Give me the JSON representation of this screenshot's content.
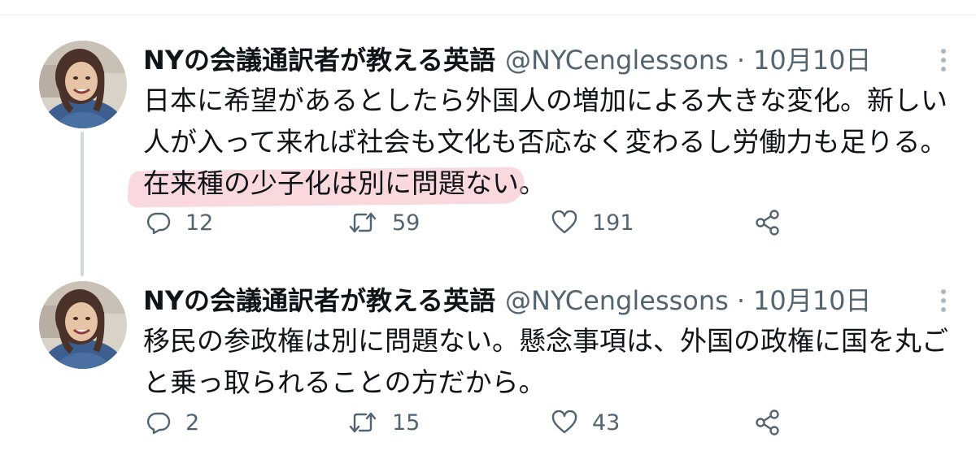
{
  "tweets": [
    {
      "display_name": "NYの会議通訳者が教える英語",
      "handle": "@NYCenglessons",
      "separator": "·",
      "date": "10月10日",
      "text_before_highlight": "日本に希望があるとしたら外国人の増加による大きな変化。新しい人が入って来れば社会も文化も否応なく変わるし労働力も足りる。",
      "text_highlighted": "在来種の少子化は別に問題ない",
      "text_after_highlight": "。",
      "highlight_color": "#f2a9b1",
      "replies": "12",
      "retweets": "59",
      "likes": "191"
    },
    {
      "display_name": "NYの会議通訳者が教える英語",
      "handle": "@NYCenglessons",
      "separator": "·",
      "date": "10月10日",
      "text": "移民の参政権は別に問題ない。懸念事項は、外国の政権に国を丸ごと乗っ取られることの方だから。",
      "replies": "2",
      "retweets": "15",
      "likes": "43"
    }
  ],
  "icons": {
    "reply": "reply-icon",
    "retweet": "retweet-icon",
    "like": "heart-icon",
    "share": "share-icon",
    "more": "more-vertical-icon"
  },
  "colors": {
    "text": "#0f1419",
    "secondary": "#536471",
    "thread_line": "#cfd9de",
    "divider": "#eff3f4",
    "more_dots": "#aab8c2"
  }
}
